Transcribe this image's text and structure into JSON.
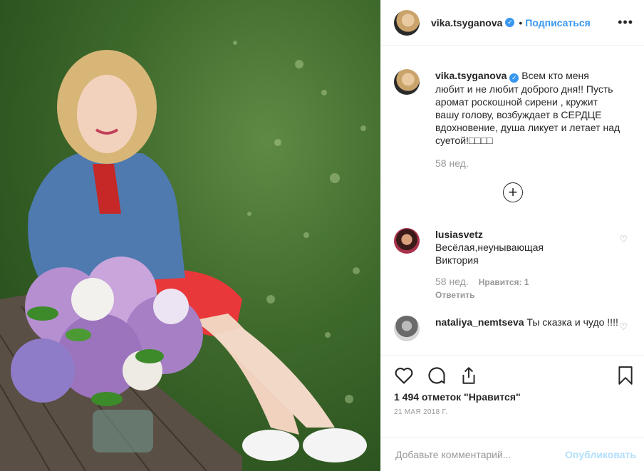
{
  "post": {
    "author": "vika.tsyganova",
    "follow_label": "Подписаться",
    "dot": "•",
    "more": "•••",
    "caption_text": "Всем кто меня любит и не любит доброго дня!! Пусть аромат роскошной сирени , кружит вашу голову, возбуждает в СЕРДЦЕ вдохновение, душа ликует и летает над суетой!",
    "caption_emoji": "□□□□",
    "caption_time": "58 нед."
  },
  "comments": [
    {
      "user": "lusiasvetz",
      "text": "Весёлая,неунывающая Виктория",
      "time": "58 нед.",
      "likes": "Нравится: 1",
      "reply": "Ответить"
    },
    {
      "user": "nataliya_nemtseva",
      "text": "Ты сказка и чудо !!!!"
    }
  ],
  "likes_label": "1 494 отметок \"Нравится\"",
  "date": "21 МАЯ 2018 Г.",
  "add_comment": {
    "placeholder": "Добавьте комментарий...",
    "publish": "Опубликовать"
  },
  "icons": {
    "like": "heart-icon",
    "comment": "comment-icon",
    "share": "share-icon",
    "save": "bookmark-icon",
    "load_more": "plus-circle-icon",
    "verified": "verified-badge-icon"
  }
}
